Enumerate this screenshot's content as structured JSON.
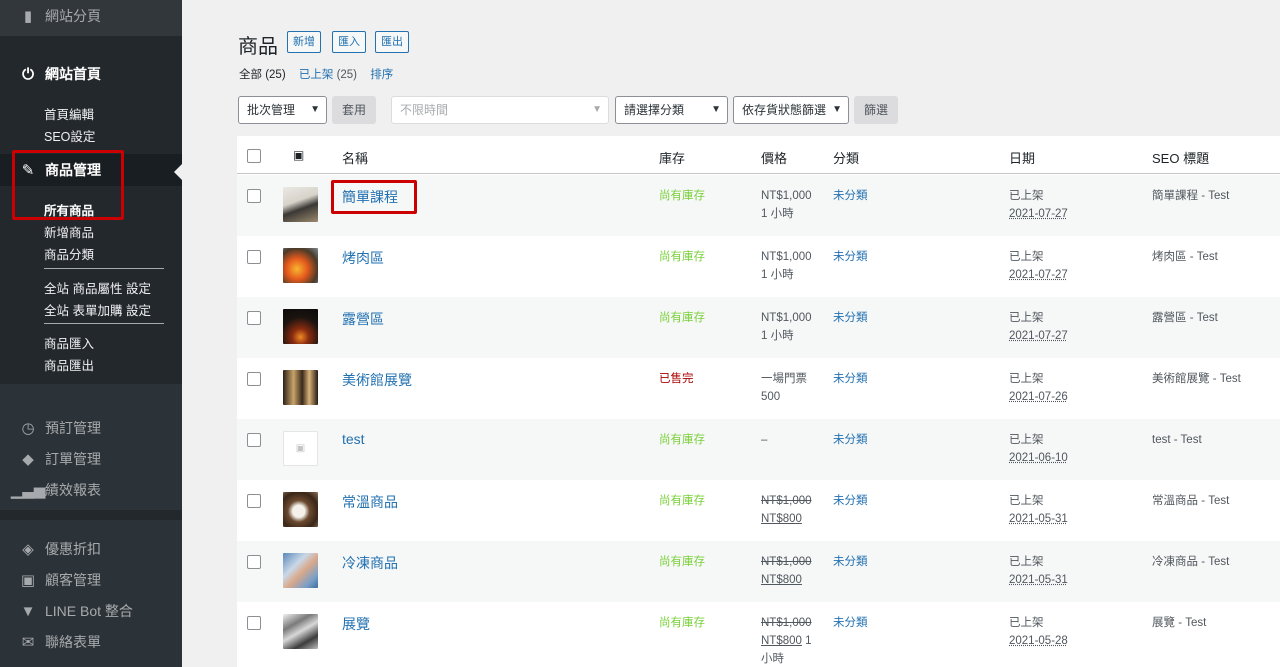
{
  "sidebar": {
    "pages": "網站分頁",
    "home": "網站首頁",
    "home_sub": [
      "首頁編輯",
      "SEO設定"
    ],
    "products": "商品管理",
    "products_sub": [
      "所有商品",
      "新增商品",
      "商品分類"
    ],
    "settings_sub": [
      "全站 商品屬性 設定",
      "全站 表單加購 設定"
    ],
    "io_sub": [
      "商品匯入",
      "商品匯出"
    ],
    "group2": [
      "預訂管理",
      "訂單管理",
      "績效報表"
    ],
    "group3": [
      "優惠折扣",
      "顧客管理",
      "LINE Bot 整合",
      "聯絡表單"
    ]
  },
  "header": {
    "title": "商品",
    "add": "新增",
    "import": "匯入",
    "export": "匯出"
  },
  "views": {
    "all": "全部",
    "all_count": "(25)",
    "published": "已上架",
    "published_count": "(25)",
    "sort": "排序"
  },
  "filters": {
    "bulk": "批次管理",
    "apply": "套用",
    "time": "不限時間",
    "category": "請選擇分類",
    "stock": "依存貨狀態篩選",
    "filter": "篩選"
  },
  "columns": {
    "name": "名稱",
    "stock": "庫存",
    "price": "價格",
    "category": "分類",
    "date": "日期",
    "seo": "SEO 標題"
  },
  "icons": {
    "image_col": "image-icon"
  },
  "products": [
    {
      "name": "簡單課程",
      "stock": "尚有庫存",
      "price1": "NT$1,000",
      "price2": "1 小時",
      "category": "未分類",
      "status": "已上架",
      "date": "2021-07-27",
      "seo": "簡單課程 - Test"
    },
    {
      "name": "烤肉區",
      "stock": "尚有庫存",
      "price1": "NT$1,000",
      "price2": "1 小時",
      "category": "未分類",
      "status": "已上架",
      "date": "2021-07-27",
      "seo": "烤肉區 - Test"
    },
    {
      "name": "露營區",
      "stock": "尚有庫存",
      "price1": "NT$1,000",
      "price2": "1 小時",
      "category": "未分類",
      "status": "已上架",
      "date": "2021-07-27",
      "seo": "露營區 - Test"
    },
    {
      "name": "美術館展覽",
      "stock": "已售完",
      "price1": "一場門票",
      "price2": "500",
      "category": "未分類",
      "status": "已上架",
      "date": "2021-07-26",
      "seo": "美術館展覽 - Test"
    },
    {
      "name": "test",
      "stock": "尚有庫存",
      "price1": "–",
      "price2": "",
      "category": "未分類",
      "status": "已上架",
      "date": "2021-06-10",
      "seo": "test - Test"
    },
    {
      "name": "常溫商品",
      "stock": "尚有庫存",
      "price_old": "NT$1,000",
      "price_new": "NT$800",
      "category": "未分類",
      "status": "已上架",
      "date": "2021-05-31",
      "seo": "常溫商品 - Test"
    },
    {
      "name": "冷凍商品",
      "stock": "尚有庫存",
      "price_old": "NT$1,000",
      "price_new": "NT$800",
      "category": "未分類",
      "status": "已上架",
      "date": "2021-05-31",
      "seo": "冷凍商品 - Test"
    },
    {
      "name": "展覽",
      "stock": "尚有庫存",
      "price_old": "NT$1,000",
      "price_new": "NT$800",
      "price_suffix": " 1",
      "price_line3": "小時",
      "category": "未分類",
      "status": "已上架",
      "date": "2021-05-28",
      "seo": "展覽 - Test"
    }
  ],
  "colors": {
    "accent": "#2271b1",
    "in_stock": "#7ad03a",
    "sold_out": "#aa0000",
    "highlight": "#cc0000"
  }
}
